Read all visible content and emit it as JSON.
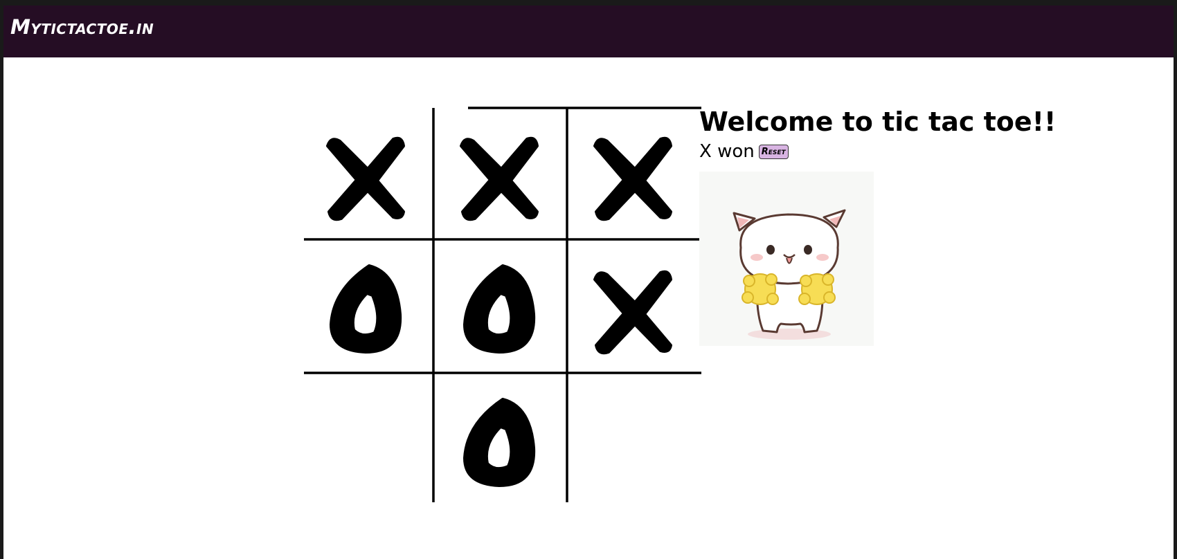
{
  "header": {
    "brand": "Mytictactoe.in",
    "bg_color": "#250d24"
  },
  "game": {
    "welcome": "Welcome to tic tac toe!!",
    "status": "X won",
    "reset_label": "Reset",
    "reset_color": "#d8b4e2",
    "board": [
      "X",
      "X",
      "X",
      "O",
      "O",
      "X",
      "",
      "O",
      ""
    ],
    "winner": "X",
    "winning_line": [
      0,
      1,
      2
    ]
  },
  "sticker": {
    "icon": "cheering-cat-icon"
  }
}
